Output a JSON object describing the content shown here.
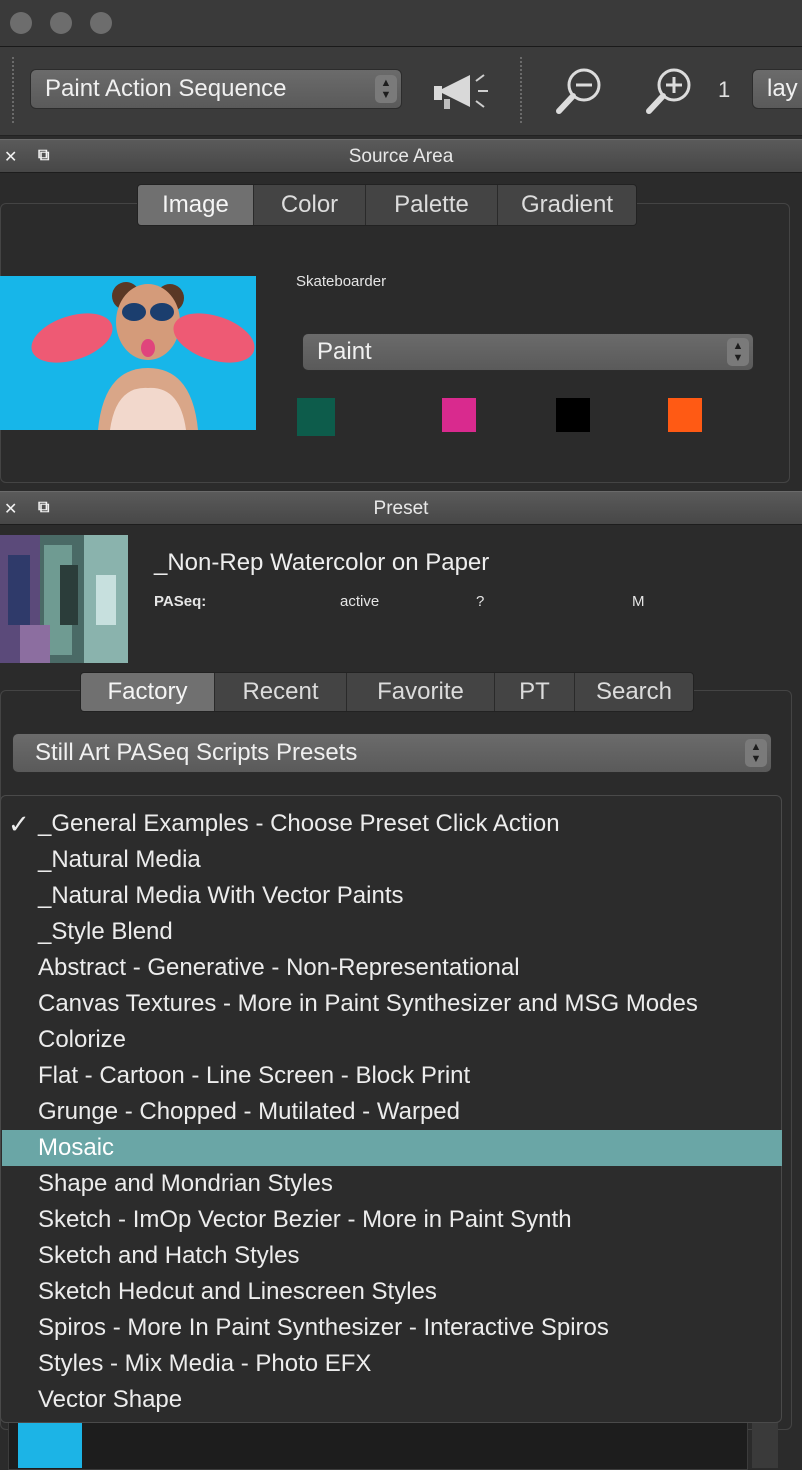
{
  "toolbar": {
    "sequence_select": "Paint Action Sequence",
    "zoom_level": "1",
    "layer_select": "lay"
  },
  "source_area": {
    "title": "Source Area",
    "tabs": [
      "Image",
      "Color",
      "Palette",
      "Gradient"
    ],
    "image_name": "Skateboarder",
    "mode_select": "Paint",
    "swatches": [
      "#0d5c4b",
      "#d92a8e",
      "#000000",
      "#ff5a14"
    ]
  },
  "preset": {
    "title": "Preset",
    "name": "_Non-Rep Watercolor on Paper",
    "paseq_label": "PASeq:",
    "status": "active",
    "question": "?",
    "m_label": "M",
    "tabs": [
      "Factory",
      "Recent",
      "Favorite",
      "PT",
      "Search"
    ],
    "category_select": "Still Art PASeq Scripts Presets",
    "check_mark": "✓",
    "list": [
      "_General Examples - Choose Preset Click Action",
      "_Natural Media",
      "_Natural Media With Vector Paints",
      "_Style Blend",
      "Abstract - Generative - Non-Representational",
      "Canvas Textures - More in Paint Synthesizer and MSG Modes",
      "Colorize",
      "Flat - Cartoon - Line Screen - Block Print",
      "Grunge - Chopped - Mutilated - Warped",
      "Mosaic",
      "Shape and Mondrian Styles",
      "Sketch - ImOp Vector Bezier - More in Paint Synth",
      "Sketch and Hatch Styles",
      "Sketch Hedcut and Linescreen Styles",
      "Spiros - More In Paint Synthesizer - Interactive Spiros",
      "Styles - Mix Media - Photo EFX",
      "Vector Shape"
    ]
  }
}
